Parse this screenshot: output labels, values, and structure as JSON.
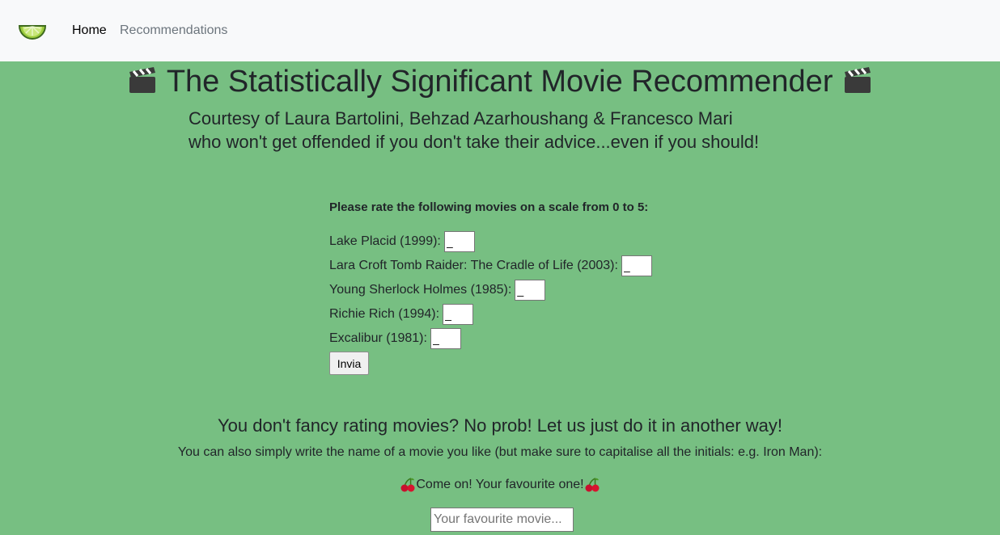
{
  "nav": {
    "logo_icon": "lime-slice-icon",
    "items": [
      {
        "label": "Home",
        "active": true
      },
      {
        "label": "Recommendations",
        "active": false
      }
    ]
  },
  "header": {
    "title": "The Statistically Significant Movie Recommender",
    "title_icon": "clapperboard-icon",
    "subtitle_line1": "Courtesy of Laura Bartolini, Behzad Azarhoushang & Francesco Mari",
    "subtitle_line2": "who won't get offended if you don't take their advice...even if you should!"
  },
  "rating_form": {
    "heading": "Please rate the following movies on a scale from 0 to 5:",
    "movies": [
      {
        "label": "Lake Placid (1999):",
        "value": "_"
      },
      {
        "label": "Lara Croft Tomb Raider: The Cradle of Life (2003):",
        "value": "_"
      },
      {
        "label": "Young Sherlock Holmes (1985):",
        "value": "_"
      },
      {
        "label": "Richie Rich (1994):",
        "value": "_"
      },
      {
        "label": "Excalibur (1981):",
        "value": "_"
      }
    ],
    "submit_label": "Invia"
  },
  "alternative": {
    "heading": "You don't fancy rating movies? No prob! Let us just do it in another way!",
    "instructions": "You can also simply write the name of a movie you like (but make sure to capitalise all the initials: e.g. Iron Man):",
    "prompt": "Come on! Your favourite one!",
    "prompt_icon": "cherries-icon",
    "input_placeholder": "Your favourite movie...",
    "input_value": ""
  },
  "colors": {
    "page_background": "#77bf82",
    "navbar_background": "#f8f9fa",
    "text": "#212529",
    "nav_inactive": "#6c757d"
  }
}
